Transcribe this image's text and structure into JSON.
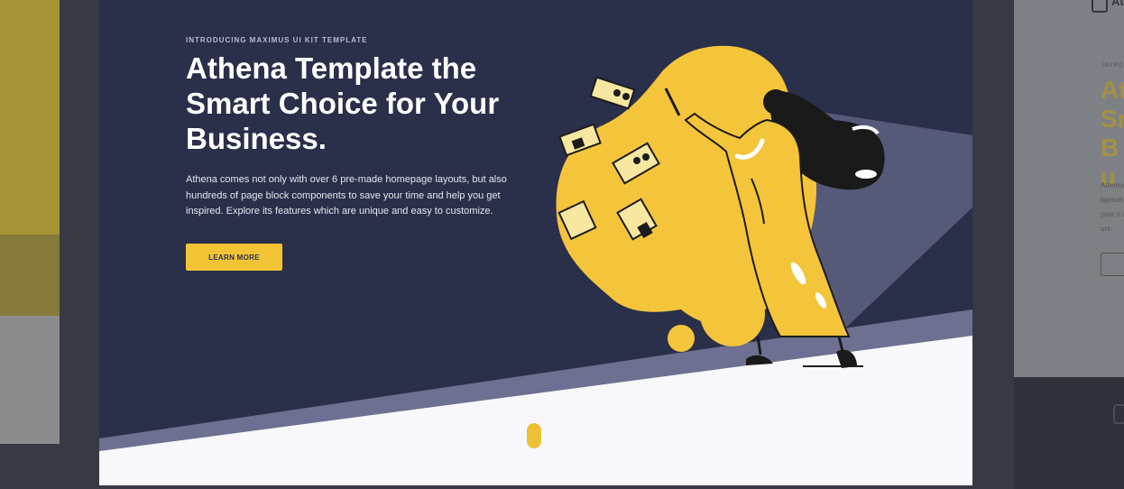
{
  "hero": {
    "eyebrow": "INTRODUCING MAXIMUS UI KIT TEMPLATE",
    "headline": "Athena Template the Smart Choice for Your Business.",
    "description": "Athena comes not only with over 6 pre-made homepage layouts, but also hundreds of page block components to save your time and help you get inspired. Explore its features which are unique and easy to customize.",
    "cta_label": "LEARN MORE"
  },
  "right_preview": {
    "title_fragment": "At",
    "eyebrow_fragment": "INTRO",
    "headline_fragment": "At Sr Bu",
    "text_fragment": "Athena layouts your ti are uni"
  },
  "colors": {
    "modal_bg": "#2a2f4a",
    "accent": "#f2c335",
    "floor": "#f8f8fc",
    "backdrop": "#373a44"
  },
  "icons": {
    "scroll_indicator": "scroll-pill-icon",
    "illustration": "woman-with-pointer-illustration"
  }
}
